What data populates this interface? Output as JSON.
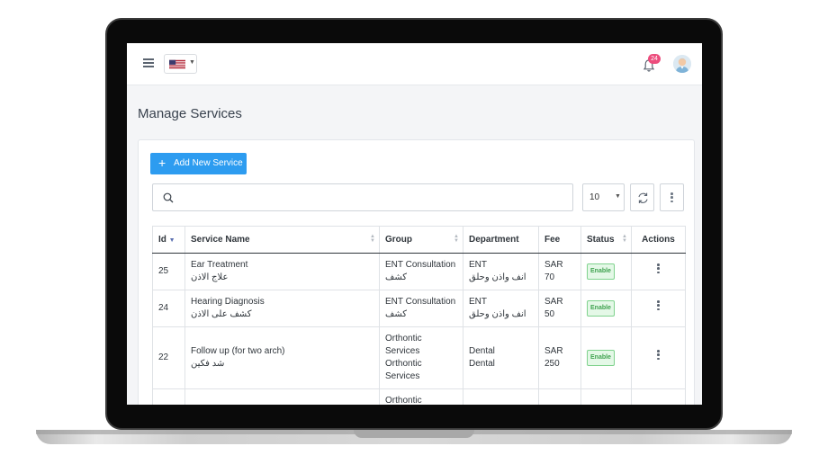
{
  "topbar": {
    "notification_count": "24"
  },
  "page": {
    "title": "Manage Services"
  },
  "toolbar": {
    "add_label": "Add New Service",
    "search_placeholder": "",
    "page_size": "10"
  },
  "table": {
    "headers": {
      "id": "Id",
      "name": "Service Name",
      "group": "Group",
      "department": "Department",
      "fee": "Fee",
      "status": "Status",
      "actions": "Actions"
    },
    "rows": [
      {
        "id": "25",
        "name_en": "Ear Treatment",
        "name_ar": "علاج الاذن",
        "group_line1": "ENT Consultation",
        "group_line2": "كشف",
        "dept_line1": "ENT",
        "dept_line2": "انف واذن وحلق",
        "fee": "SAR 70",
        "status": "Enable"
      },
      {
        "id": "24",
        "name_en": "Hearing Diagnosis",
        "name_ar": "كشف على الاذن",
        "group_line1": "ENT Consultation",
        "group_line2": "كشف",
        "dept_line1": "ENT",
        "dept_line2": "انف واذن وحلق",
        "fee": "SAR 50",
        "status": "Enable"
      },
      {
        "id": "22",
        "name_en": "Follow up (for two arch)",
        "name_ar": "شد فكين",
        "group_line1": "Orthontic",
        "group_line2": "Services",
        "group_line3": "Orthontic",
        "group_line4": "Services",
        "dept_line1": "Dental",
        "dept_line2": "Dental",
        "fee_line1": "SAR",
        "fee_line2": "250",
        "status": "Enable"
      },
      {
        "group_line1": "Orthontic"
      }
    ]
  },
  "colors": {
    "accent": "#2d9cf0",
    "badge": "#ec4d7d",
    "status_enable": "#3fa24f"
  },
  "icons": [
    "menu-icon",
    "us-flag-icon",
    "bell-icon",
    "avatar-icon",
    "plus-icon",
    "search-icon",
    "refresh-icon",
    "kebab-icon"
  ]
}
